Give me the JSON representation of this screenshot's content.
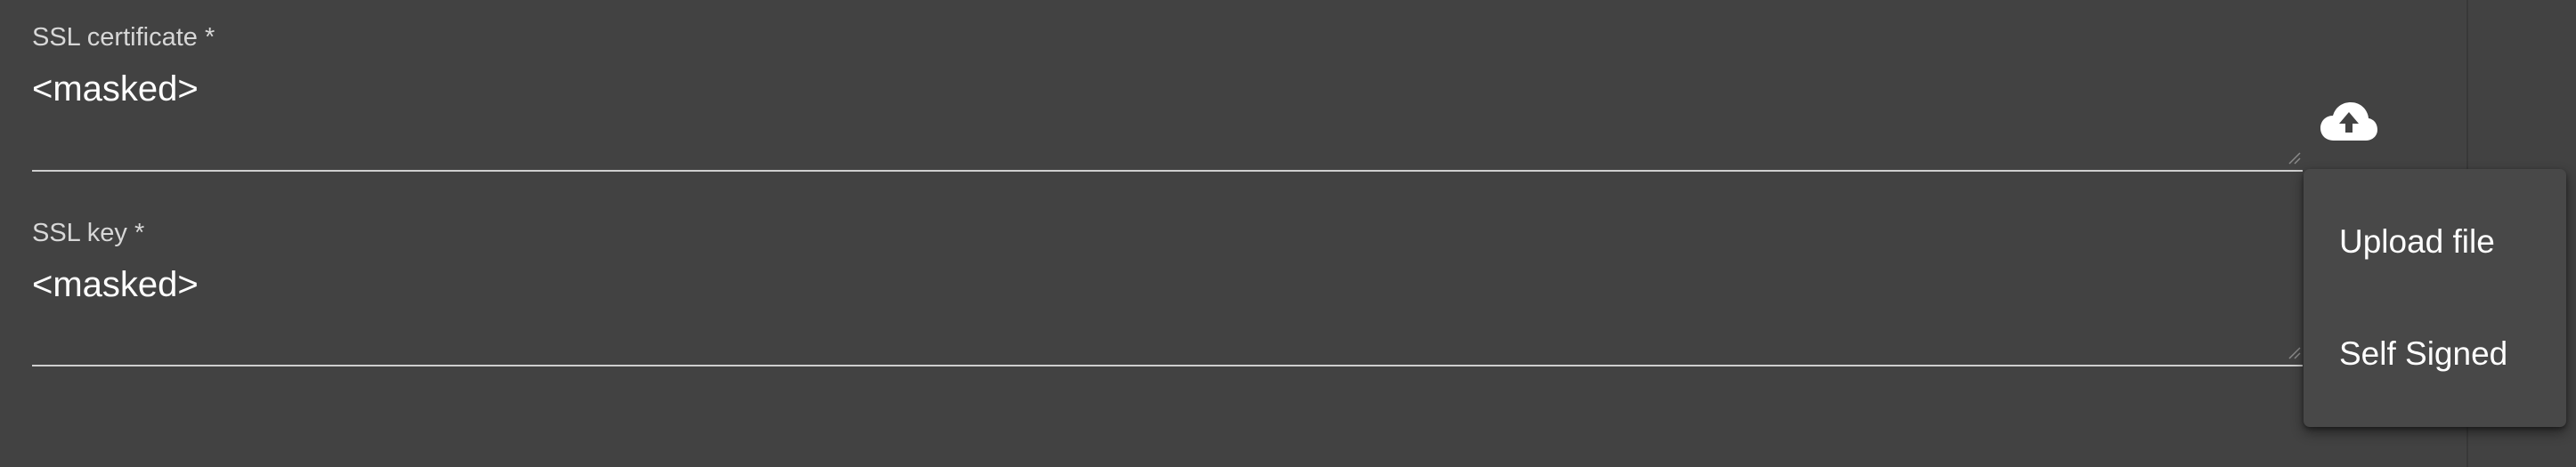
{
  "fields": {
    "ssl_certificate": {
      "label": "SSL certificate *",
      "value": "<masked>"
    },
    "ssl_key": {
      "label": "SSL key *",
      "value": "<masked>"
    }
  },
  "upload_button": {
    "icon": "cloud-upload-icon"
  },
  "menu": {
    "items": [
      {
        "label": "Upload file"
      },
      {
        "label": "Self Signed"
      }
    ]
  },
  "colors": {
    "background": "#424242",
    "menu_background": "#484848",
    "text": "#ffffff",
    "label": "#d7d7d7",
    "underline": "#cfcfcf"
  }
}
